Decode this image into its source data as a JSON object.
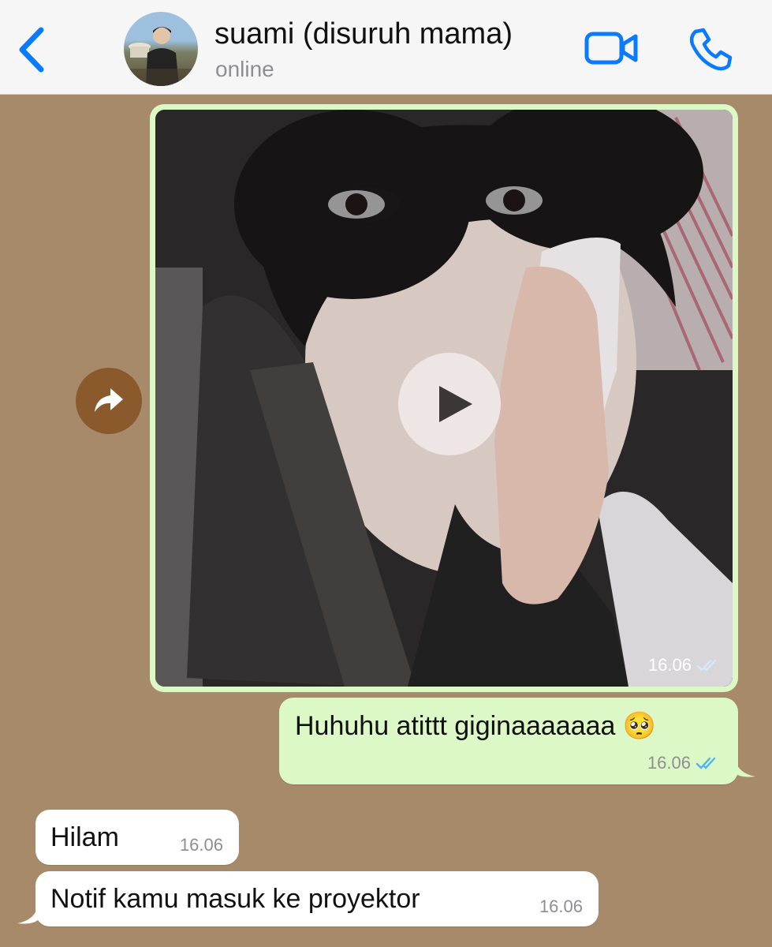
{
  "header": {
    "contact_name": "suami (disuruh mama)",
    "status": "online"
  },
  "colors": {
    "accent": "#0a7aff",
    "chat_background": "#a78a6a",
    "outgoing_bubble": "#dcf8c6",
    "incoming_bubble": "#ffffff",
    "read_ticks": "#4fb3f6",
    "forward_button": "#8a5a2c"
  },
  "icons": {
    "back": "chevron-left-icon",
    "video_call": "video-camera-icon",
    "voice_call": "phone-icon",
    "forward": "share-arrow-icon",
    "play": "play-icon",
    "read_receipt": "double-check-icon"
  },
  "messages": [
    {
      "type": "video",
      "direction": "outgoing",
      "time": "16.06",
      "status": "read"
    },
    {
      "type": "text",
      "direction": "outgoing",
      "text": "Huhuhu atittt giginaaaaaaa 🥺",
      "time": "16.06",
      "status": "read"
    },
    {
      "type": "text",
      "direction": "incoming",
      "text": "Hilam",
      "time": "16.06"
    },
    {
      "type": "text",
      "direction": "incoming",
      "text": "Notif kamu masuk ke proyektor",
      "time": "16.06"
    }
  ]
}
